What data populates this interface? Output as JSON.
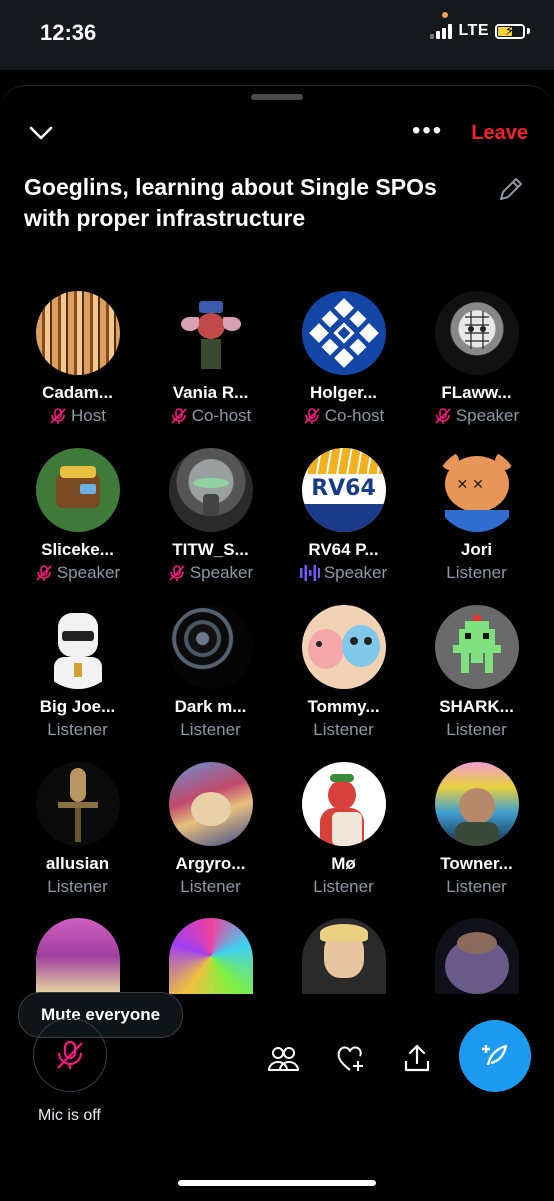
{
  "status": {
    "time": "12:36",
    "network": "LTE"
  },
  "header": {
    "leave_label": "Leave",
    "title": "Goeglins, learning about Single SPOs with proper infrastructure"
  },
  "participants": [
    {
      "name": "Cadam...",
      "role": "Host",
      "mic": "muted"
    },
    {
      "name": "Vania R...",
      "role": "Co-host",
      "mic": "muted"
    },
    {
      "name": "Holger...",
      "role": "Co-host",
      "mic": "muted"
    },
    {
      "name": "FLaww...",
      "role": "Speaker",
      "mic": "muted"
    },
    {
      "name": "Sliceke...",
      "role": "Speaker",
      "mic": "muted"
    },
    {
      "name": "TITW_S...",
      "role": "Speaker",
      "mic": "muted"
    },
    {
      "name": "RV64 P...",
      "role": "Speaker",
      "mic": "speaking",
      "avatar_text": "RV64"
    },
    {
      "name": "Jori",
      "role": "Listener",
      "mic": "none"
    },
    {
      "name": "Big Joe...",
      "role": "Listener",
      "mic": "none"
    },
    {
      "name": "Dark m...",
      "role": "Listener",
      "mic": "none"
    },
    {
      "name": "Tommy...",
      "role": "Listener",
      "mic": "none"
    },
    {
      "name": "SHARK...",
      "role": "Listener",
      "mic": "none"
    },
    {
      "name": "allusian",
      "role": "Listener",
      "mic": "none"
    },
    {
      "name": "Argyro...",
      "role": "Listener",
      "mic": "none"
    },
    {
      "name": "Mø",
      "role": "Listener",
      "mic": "none"
    },
    {
      "name": "Towner...",
      "role": "Listener",
      "mic": "none"
    }
  ],
  "mute_everyone_label": "Mute everyone",
  "bottom_bar": {
    "mic_label": "Mic is off"
  },
  "colors": {
    "leave": "#f4212e",
    "accent": "#1d9bf0",
    "muted_mic": "#f91880",
    "speaking": "#7856ff",
    "secondary_text": "#8b98a5"
  },
  "icons": [
    "chevron-down-icon",
    "more-icon",
    "edit-icon",
    "mic-off-icon",
    "speaking-icon",
    "people-icon",
    "heart-plus-icon",
    "share-icon",
    "compose-icon"
  ]
}
